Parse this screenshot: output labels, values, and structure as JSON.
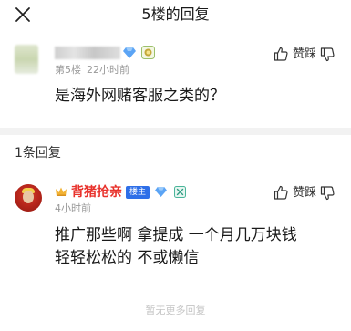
{
  "header": {
    "title": "5楼的回复",
    "close_icon": "close-icon"
  },
  "post": {
    "floor": "第5楼",
    "time": "22小时前",
    "content": "是海外网赌客服之类的？",
    "like_label": "赞",
    "dislike_label": "踩",
    "badge_icons": [
      "gem-icon",
      "medal-icon"
    ]
  },
  "replies": {
    "count_label": "1条回复",
    "items": [
      {
        "username": "背猪抢亲",
        "host_badge": "楼主",
        "time": "4小时前",
        "content_line1": "推广那些啊 拿提成 一个月几万块钱",
        "content_line2": "轻轻松松的 不或懒信",
        "like_label": "赞",
        "dislike_label": "踩",
        "username_color": "#e8322c",
        "badge_color": "#2e6fe8"
      }
    ],
    "no_more": "暂无更多回复"
  }
}
